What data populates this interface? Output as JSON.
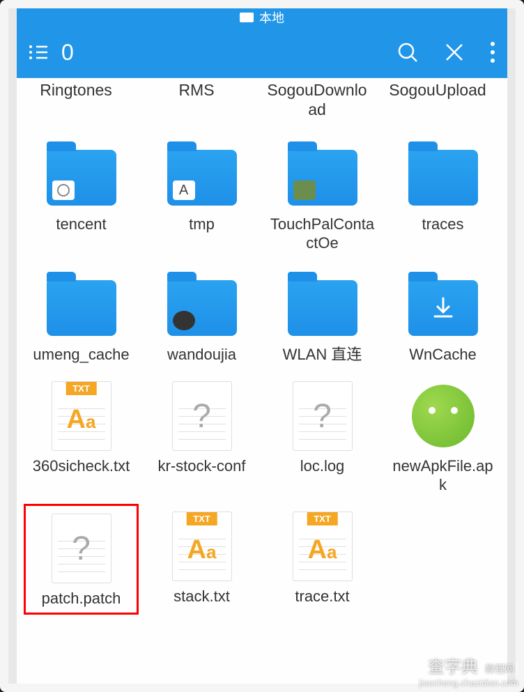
{
  "statusbar": {
    "location_label": "本地"
  },
  "toolbar": {
    "selection_count": "0"
  },
  "top_row_labels": [
    "Ringtones",
    "RMS",
    "SogouDownload",
    "SogouUpload"
  ],
  "grid": [
    {
      "name": "tencent",
      "type": "folder",
      "badge": "camera"
    },
    {
      "name": "tmp",
      "type": "folder",
      "badge": "A"
    },
    {
      "name": "TouchPalContactOe",
      "type": "folder",
      "badge": "app"
    },
    {
      "name": "traces",
      "type": "folder"
    },
    {
      "name": "umeng_cache",
      "type": "folder"
    },
    {
      "name": "wandoujia",
      "type": "folder",
      "badge": "swirl"
    },
    {
      "name": "WLAN 直连",
      "type": "folder"
    },
    {
      "name": "WnCache",
      "type": "folder",
      "badge": "download"
    },
    {
      "name": "360sicheck.txt",
      "type": "txt"
    },
    {
      "name": "kr-stock-conf",
      "type": "unknown"
    },
    {
      "name": "loc.log",
      "type": "unknown"
    },
    {
      "name": "newApkFile.apk",
      "type": "apk"
    },
    {
      "name": "patch.patch",
      "type": "unknown",
      "highlighted": true
    },
    {
      "name": "stack.txt",
      "type": "txt"
    },
    {
      "name": "trace.txt",
      "type": "txt"
    }
  ],
  "file_labels": {
    "txt_tag": "TXT",
    "aa_big": "A",
    "aa_small": "a",
    "unknown_mark": "?"
  },
  "watermark": {
    "line1": "查字典",
    "tag": "教程网",
    "line2": "jiaocheng.chazidian.com"
  }
}
